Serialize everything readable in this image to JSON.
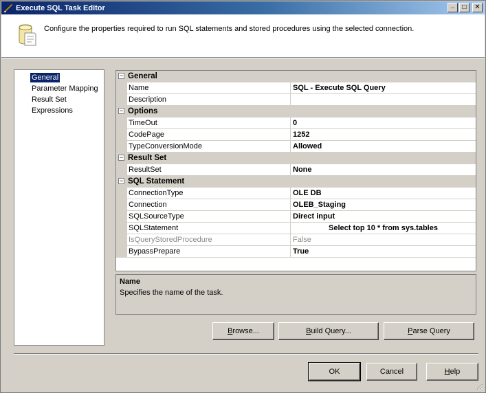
{
  "window": {
    "title": "Execute SQL Task Editor",
    "minimize": "_",
    "maximize": "□",
    "close": "✕"
  },
  "header": {
    "description": "Configure the properties required to run SQL statements and stored procedures using the selected connection."
  },
  "nav": {
    "items": [
      {
        "label": "General",
        "selected": true
      },
      {
        "label": "Parameter Mapping",
        "selected": false
      },
      {
        "label": "Result Set",
        "selected": false
      },
      {
        "label": "Expressions",
        "selected": false
      }
    ]
  },
  "grid": {
    "categories": {
      "general": "General",
      "options": "Options",
      "result_set": "Result Set",
      "sql_statement": "SQL Statement"
    },
    "expander": "⊟",
    "props": {
      "name": {
        "name": "Name",
        "value": "SQL - Execute SQL Query"
      },
      "description": {
        "name": "Description",
        "value": ""
      },
      "timeout": {
        "name": "TimeOut",
        "value": "0"
      },
      "codepage": {
        "name": "CodePage",
        "value": "1252"
      },
      "typeconv": {
        "name": "TypeConversionMode",
        "value": "Allowed"
      },
      "resultset": {
        "name": "ResultSet",
        "value": "None"
      },
      "conntype": {
        "name": "ConnectionType",
        "value": "OLE DB"
      },
      "connection": {
        "name": "Connection",
        "value": "OLEB_Staging"
      },
      "sqlsource": {
        "name": "SQLSourceType",
        "value": "Direct input"
      },
      "sqlstatement": {
        "name": "SQLStatement",
        "value": "Select top 10 * from sys.tables"
      },
      "isquery": {
        "name": "IsQueryStoredProcedure",
        "value": "False"
      },
      "bypass": {
        "name": "BypassPrepare",
        "value": "True"
      }
    }
  },
  "description_panel": {
    "title": "Name",
    "text": "Specifies the name of the task."
  },
  "buttons": {
    "browse": {
      "hot": "B",
      "rest": "rowse..."
    },
    "build_query": {
      "hot": "B",
      "rest": "uild Query..."
    },
    "parse_query": {
      "hot": "P",
      "rest": "arse Query"
    },
    "ok": "OK",
    "cancel": "Cancel",
    "help": {
      "hot": "H",
      "rest": "elp"
    }
  },
  "colors": {
    "titlebar_start": "#0a246a",
    "titlebar_end": "#a6caf0",
    "selection": "#0a246a",
    "face": "#d4d0c8"
  }
}
